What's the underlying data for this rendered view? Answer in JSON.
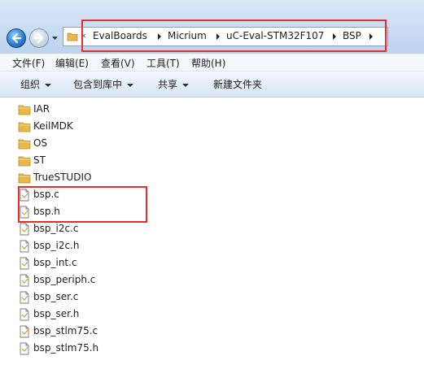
{
  "address": {
    "more": "«",
    "crumbs": [
      "EvalBoards",
      "Micrium",
      "uC-Eval-STM32F107",
      "BSP"
    ]
  },
  "menu": [
    "文件(F)",
    "编辑(E)",
    "查看(V)",
    "工具(T)",
    "帮助(H)"
  ],
  "toolbar": {
    "organize": "组织",
    "include_library": "包含到库中",
    "share": "共享",
    "new_folder": "新建文件夹"
  },
  "items": [
    {
      "name": "IAR",
      "kind": "folder"
    },
    {
      "name": "KeilMDK",
      "kind": "folder"
    },
    {
      "name": "OS",
      "kind": "folder"
    },
    {
      "name": "ST",
      "kind": "folder"
    },
    {
      "name": "TrueSTUDIO",
      "kind": "folder"
    },
    {
      "name": "bsp.c",
      "kind": "file"
    },
    {
      "name": "bsp.h",
      "kind": "file"
    },
    {
      "name": "bsp_i2c.c",
      "kind": "file"
    },
    {
      "name": "bsp_i2c.h",
      "kind": "file"
    },
    {
      "name": "bsp_int.c",
      "kind": "file"
    },
    {
      "name": "bsp_periph.c",
      "kind": "file"
    },
    {
      "name": "bsp_ser.c",
      "kind": "file"
    },
    {
      "name": "bsp_ser.h",
      "kind": "file"
    },
    {
      "name": "bsp_stlm75.c",
      "kind": "file"
    },
    {
      "name": "bsp_stlm75.h",
      "kind": "file"
    }
  ],
  "colors": {
    "highlight": "#e0312e",
    "folder": "#e8b84a"
  }
}
